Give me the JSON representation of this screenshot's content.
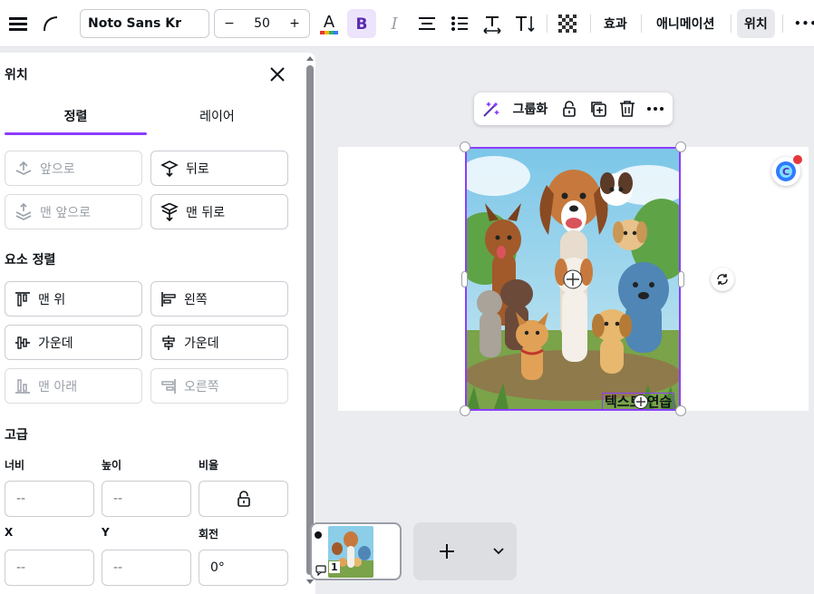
{
  "toolbar": {
    "font_family": "Noto Sans Kr",
    "font_size": "50",
    "minus": "−",
    "plus": "+",
    "italic": "I",
    "effects": "효과",
    "animation": "애니메이션",
    "position": "위치",
    "more": "•••"
  },
  "panel": {
    "title": "위치",
    "tabs": [
      "정렬",
      "레이어"
    ],
    "order_buttons": [
      "앞으로",
      "뒤로",
      "맨 앞으로",
      "맨 뒤로"
    ],
    "align_section": "요소 정렬",
    "align_buttons": [
      "맨 위",
      "왼쪽",
      "가운데",
      "가운데",
      "맨 아래",
      "오른쪽"
    ],
    "advanced_section": "고급",
    "width_label": "너비",
    "height_label": "높이",
    "ratio_label": "비율",
    "x_label": "X",
    "y_label": "Y",
    "rotation_label": "회전",
    "width_value": "--",
    "height_value": "--",
    "x_value": "--",
    "y_value": "--",
    "rotation_value": "0°"
  },
  "floating_bar": {
    "group_label": "그룹화"
  },
  "canvas": {
    "text": "텍스트 연습"
  },
  "pages": {
    "page_number": "1"
  },
  "colors": {
    "accent": "#8b3dff",
    "text_color_bar": "#e5382c"
  }
}
